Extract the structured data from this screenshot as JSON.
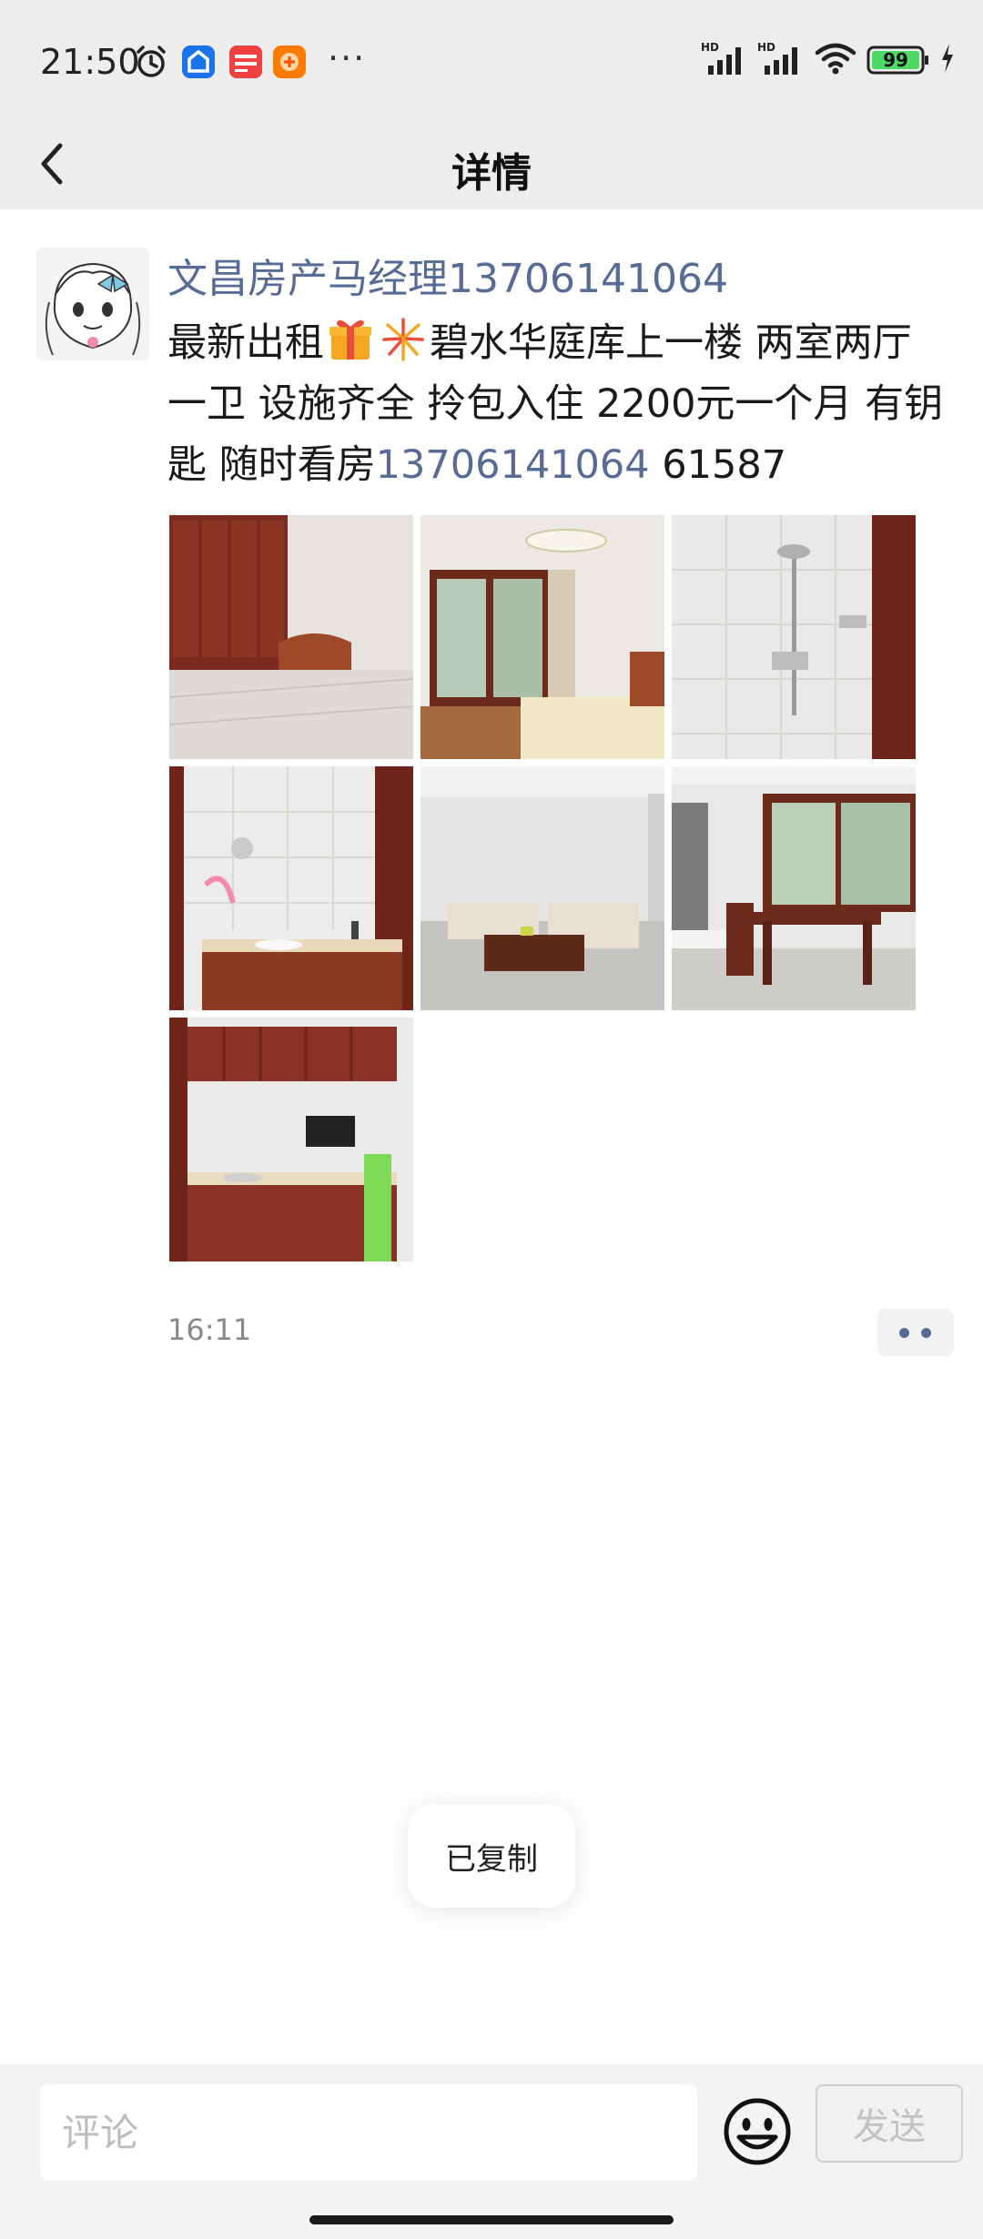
{
  "status_bar": {
    "time": "21:50",
    "more": "···",
    "battery": "99",
    "network_labels": [
      "HD",
      "HD"
    ],
    "app_icons": [
      "alarm-icon",
      "app-blue-icon",
      "toutiao-icon",
      "taobao-icon"
    ]
  },
  "header": {
    "title": "详情"
  },
  "post": {
    "author": "文昌房产马经理13706141064",
    "text_before_emoji": "最新出租",
    "text_after_emoji": "碧水华庭库上一楼  两室两厅一卫  设施齐全  拎包入住  2200元一个月  有钥匙  随时看房",
    "phone": "13706141064",
    "text_tail": "  61587",
    "emojis": [
      "gift-emoji",
      "fireworks-emoji"
    ],
    "photos": [
      {
        "name": "bedroom-photo-1"
      },
      {
        "name": "bedroom-photo-2"
      },
      {
        "name": "shower-photo"
      },
      {
        "name": "bathroom-sink-photo"
      },
      {
        "name": "living-room-photo"
      },
      {
        "name": "dining-room-photo"
      },
      {
        "name": "kitchen-photo"
      }
    ],
    "time": "16:11"
  },
  "toast": {
    "message": "已复制"
  },
  "comment_bar": {
    "placeholder": "评论",
    "send_label": "发送"
  },
  "colors": {
    "link": "#576b95",
    "header_bg": "#ededed",
    "battery_green": "#4cd964"
  }
}
